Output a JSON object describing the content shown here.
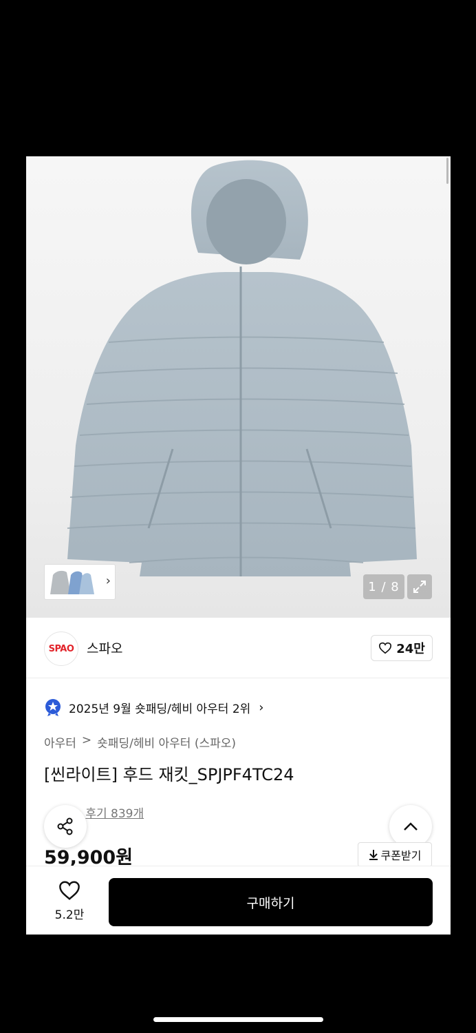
{
  "gallery": {
    "counter": "1 / 8",
    "expand_icon": "expand-icon",
    "thumb_chevron": "›"
  },
  "brand": {
    "logo_text": "SPAO",
    "logo_color": "#e2232a",
    "name": "스파오",
    "like_count": "24만"
  },
  "ranking": {
    "text": "2025년 9월 숏패딩/헤비 아우터 2위",
    "chevron": "›"
  },
  "breadcrumb": {
    "level1": "아우터",
    "separator": ">",
    "level2": "숏패딩/헤비 아우터 (스파오)"
  },
  "product": {
    "title": "[씬라이트] 후드 재킷_SPJPF4TC24",
    "review_label": "후기 839개",
    "price": "59,900원"
  },
  "actions": {
    "coupon_label": "쿠폰받기",
    "wish_count": "5.2만",
    "buy_label": "구매하기"
  }
}
